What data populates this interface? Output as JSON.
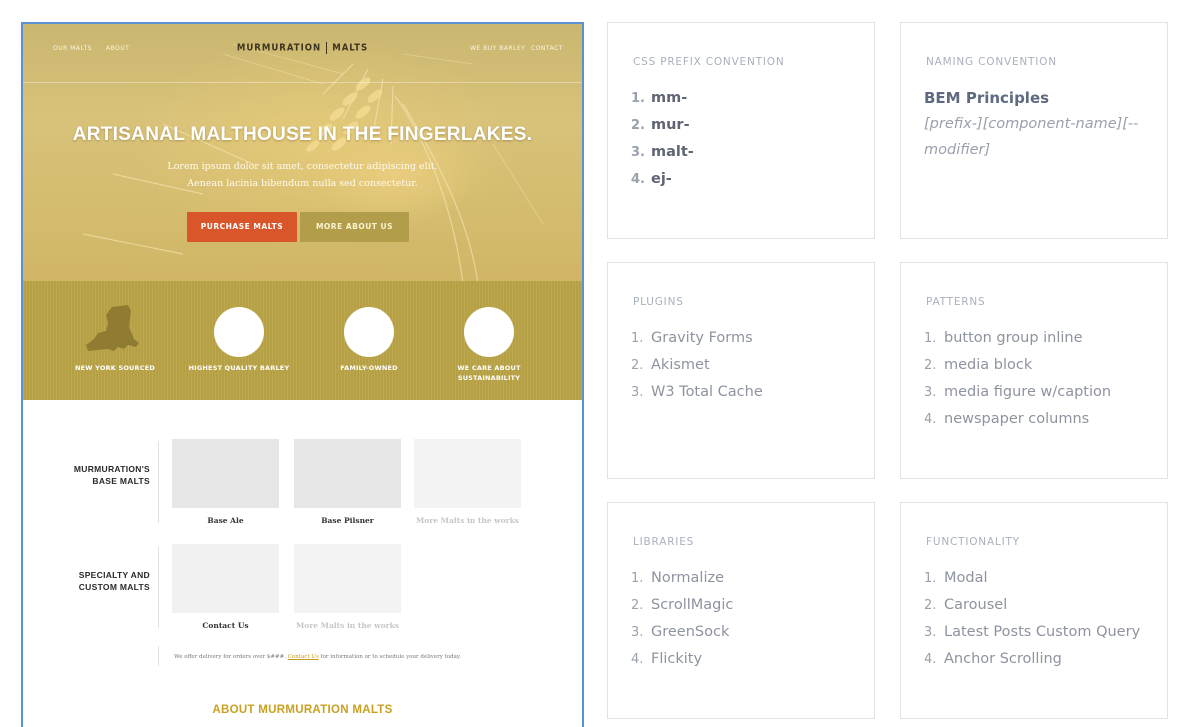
{
  "mockup": {
    "nav": {
      "left": [
        "OUR MALTS",
        "ABOUT"
      ],
      "right": [
        "WE BUY BARLEY",
        "CONTACT"
      ],
      "logo_word1": "MURMURATION",
      "logo_word2": "MALTS"
    },
    "hero": {
      "headline": "ARTISANAL MALTHOUSE IN THE FINGERLAKES.",
      "sub_line1": "Lorem ipsum dolor sit amet, consectetur adipiscing elit.",
      "sub_line2": "Aenean lacinia bibendum nulla sed consectetur.",
      "primary_button": "PURCHASE MALTS",
      "secondary_button": "MORE ABOUT US"
    },
    "features": [
      {
        "label_line1": "NEW YORK SOURCED",
        "label_line2": "",
        "icon": "new-york-state-icon"
      },
      {
        "label_line1": "HIGHEST QUALITY BARLEY",
        "label_line2": "",
        "icon": "circle-placeholder"
      },
      {
        "label_line1": "FAMILY-OWNED",
        "label_line2": "",
        "icon": "circle-placeholder"
      },
      {
        "label_line1": "WE CARE ABOUT",
        "label_line2": "SUSTAINABILITY",
        "icon": "circle-placeholder"
      }
    ],
    "base_malts": {
      "heading_line1": "MURMURATION'S",
      "heading_line2": "BASE MALTS",
      "cards": [
        "Base Ale",
        "Base Pilsner",
        "More Malts in the works"
      ]
    },
    "specialty_malts": {
      "heading_line1": "SPECIALTY AND",
      "heading_line2": "CUSTOM MALTS",
      "cards": [
        "Contact Us",
        "More Malts in the works"
      ]
    },
    "delivery": {
      "before": "We offer delivery for orders over $###.",
      "link": "Contact Us",
      "after": "for information or to schedule your delivery today."
    },
    "about_heading": "ABOUT MURMURATION MALTS"
  },
  "panels": {
    "css_prefix": {
      "title": "CSS PREFIX CONVENTION",
      "items": [
        "mm-",
        "mur-",
        "malt-",
        "ej-"
      ]
    },
    "naming": {
      "title": "NAMING CONVENTION",
      "heading": "BEM Principles",
      "pattern": "[prefix-][component-name][--modifier]"
    },
    "plugins": {
      "title": "PLUGINS",
      "items": [
        "Gravity Forms",
        "Akismet",
        "W3 Total Cache"
      ]
    },
    "patterns": {
      "title": "PATTERNS",
      "items": [
        "button group inline",
        "media block",
        "media figure w/caption",
        "newspaper columns"
      ]
    },
    "libraries": {
      "title": "LIBRARIES",
      "items": [
        "Normalize",
        "ScrollMagic",
        "GreenSock",
        "Flickity"
      ]
    },
    "functionality": {
      "title": "FUNCTIONALITY",
      "items": [
        "Modal",
        "Carousel",
        "Latest Posts Custom Query",
        "Anchor Scrolling"
      ]
    }
  },
  "colors": {
    "accent_blue": "#5b90d4",
    "purchase_orange": "#d9552a",
    "feature_gold": "#bba548",
    "heading_gold": "#c9a01f"
  }
}
